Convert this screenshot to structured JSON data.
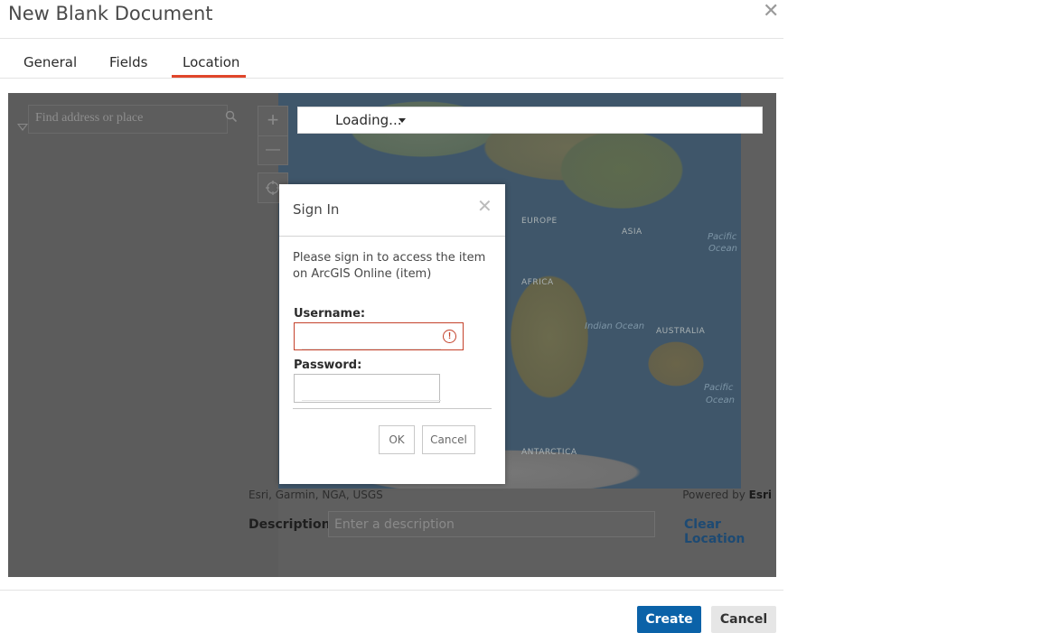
{
  "dialog": {
    "title": "New Blank Document",
    "close_icon": "close-icon",
    "tabs": [
      {
        "label": "General"
      },
      {
        "label": "Fields"
      },
      {
        "label": "Location",
        "active": true
      }
    ]
  },
  "map": {
    "search_placeholder": "Find address or place",
    "search_icon": "search-icon",
    "zoom_in": "+",
    "zoom_out": "—",
    "basemap_label": "Loading...",
    "labels": {
      "europe": "EUROPE",
      "asia": "ASIA",
      "africa": "AFRICA",
      "australia": "AUSTRALIA",
      "antarctica": "ANTARCTICA",
      "indian_ocean": "Indian Ocean",
      "pacific1": "Pacific",
      "ocean1": "Ocean",
      "pacific2": "Pacific",
      "ocean2": "Ocean"
    },
    "attribution": "Esri, Garmin, NGA, USGS",
    "powered_prefix": "Powered by ",
    "powered_brand": "Esri"
  },
  "location": {
    "description_label": "Description:",
    "description_placeholder": "Enter a description",
    "clear_label": "Clear Location"
  },
  "signin": {
    "title": "Sign In",
    "message": "Please sign in to access the item on ArcGIS Online (item)",
    "username_label": "Username:",
    "password_label": "Password:",
    "ok_label": "OK",
    "cancel_label": "Cancel",
    "error_color": "#c4422b"
  },
  "footer": {
    "create_label": "Create",
    "cancel_label": "Cancel",
    "accent": "#0b62a8"
  }
}
